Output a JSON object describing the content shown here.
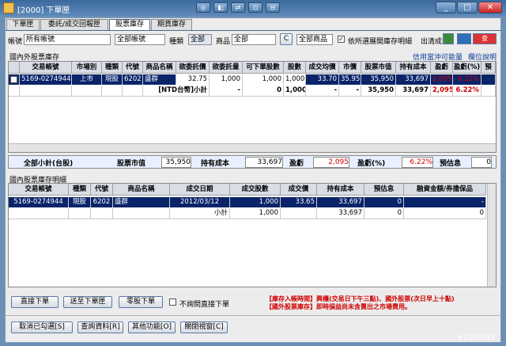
{
  "window": {
    "title": "[2000] 下單匣"
  },
  "titlebar_buttons": [
    "◎",
    "◧",
    "⇄",
    "⊡",
    "⊟"
  ],
  "tabs": [
    "下單匣",
    "委託/成交回報匣",
    "股票庫存",
    "期貨庫存"
  ],
  "filters": {
    "account_label": "帳號",
    "account_value": "所有帳號",
    "account_name": "全部帳號",
    "type_label": "種類",
    "type_value": "全部",
    "product_label": "商品",
    "product_value": "全部",
    "c_button": "C",
    "product_name": "全部商品",
    "detail_label": "依所選展開庫存明細",
    "clear_label": "出清成交"
  },
  "domestic": {
    "section_title": "國內外股票庫存",
    "link1": "信用當沖可能量",
    "link2": "欄位說明",
    "headers": [
      "",
      "交易帳號",
      "市場別",
      "種類",
      "代號",
      "商品名稱",
      "欲委託價",
      "欲委託量",
      "可下單股數",
      "股數",
      "成交均價",
      "市價",
      "股票市值",
      "持有成本",
      "盈虧",
      "盈虧(%)",
      "預"
    ],
    "row": [
      "",
      "5169-0274944",
      "上市",
      "現股",
      "6202",
      "盛群",
      "32.75",
      "1,000",
      "1,000",
      "1,000",
      "33.70",
      "35.95",
      "35,950",
      "33,697",
      "2,095",
      "6.22%"
    ],
    "subtotal": [
      "",
      "",
      "",
      "",
      "",
      "[NTD台幣]小計",
      "-",
      "-",
      "0",
      "1,000",
      "-",
      "-",
      "35,950",
      "33,697",
      "2,095",
      "6.22%"
    ]
  },
  "summary": {
    "total_label": "全部小計(台股)",
    "mv_label": "股票市值",
    "mv": "35,950",
    "cost_label": "持有成本",
    "cost": "33,697",
    "pl_label": "盈虧",
    "pl": "2,095",
    "plp_label": "盈虧(%)",
    "plp": "6.22%",
    "est_label": "預估息",
    "est": "0"
  },
  "detail": {
    "section_title": "國內股票庫存明細",
    "headers": [
      "交易帳號",
      "種類",
      "代號",
      "商品名稱",
      "成交日期",
      "成交股數",
      "成交價",
      "持有成本",
      "預估息",
      "融資金額/券擔保品"
    ],
    "row": [
      "5169-0274944",
      "現股",
      "6202",
      "盛群",
      "2012/03/12",
      "1,000",
      "33.65",
      "33,697",
      "0",
      "-"
    ],
    "subtotal": [
      "",
      "",
      "",
      "",
      "小計",
      "1,000",
      "",
      "33,697",
      "0",
      "0"
    ]
  },
  "actions": {
    "direct": "直接下單",
    "to_box": "送至下單匣",
    "odd": "零股下單",
    "no_confirm": "不詢問直接下單"
  },
  "notes": {
    "line1_tag": "【庫存入帳時間】",
    "line1_text": "興櫃(交易日下午三點)、國外股票(次日早上十點)",
    "line2_tag": "【國外股票庫存】",
    "line2_text": "即時損益尚未含賣出之市場費用。"
  },
  "bottom": {
    "cancel": "取消已勾選[S]",
    "query": "查詢資料[R]",
    "more": "其他功能[O]",
    "close": "關閉視窗[C]"
  },
  "watermark": "#1956585"
}
